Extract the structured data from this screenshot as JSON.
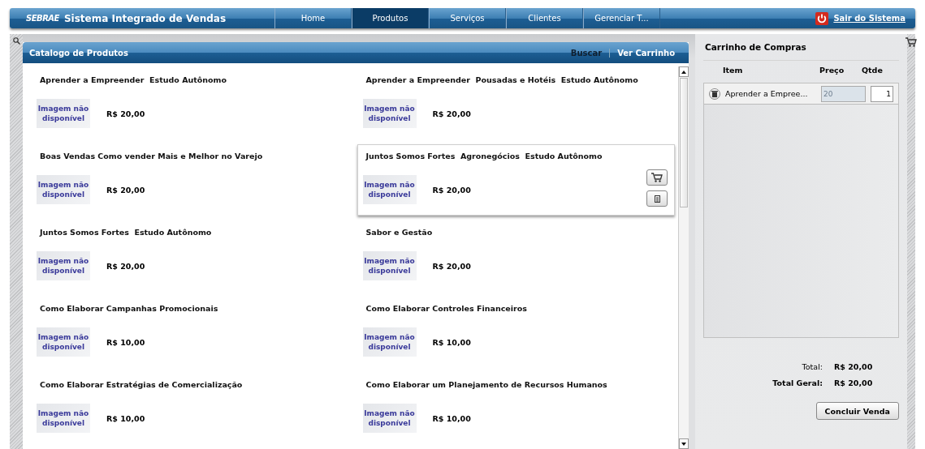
{
  "header": {
    "logo": "SEBRAE",
    "title": "Sistema Integrado de Vendas",
    "logout": "Sair do Sistema"
  },
  "nav": [
    {
      "label": "Home",
      "selected": false
    },
    {
      "label": "Produtos",
      "selected": true
    },
    {
      "label": "Serviços",
      "selected": false
    },
    {
      "label": "Clientes",
      "selected": false
    },
    {
      "label": "Gerenciar T...",
      "selected": false
    }
  ],
  "catalog": {
    "title": "Catalogo de Produtos",
    "actions": [
      "Buscar",
      "Ver Carrinho"
    ],
    "products": [
      {
        "name": "Aprender a Empreender  Estudo Autônomo",
        "image": "Imagem não disponível",
        "price": "R$ 20,00",
        "hovered": false
      },
      {
        "name": "Aprender a Empreender  Pousadas e Hotéis  Estudo Autônomo",
        "image": "Imagem não disponível",
        "price": "R$ 20,00",
        "hovered": false
      },
      {
        "name": "Boas Vendas Como vender Mais e Melhor no Varejo",
        "image": "Imagem não disponível",
        "price": "R$ 20,00",
        "hovered": false
      },
      {
        "name": "Juntos Somos Fortes  Agronegócios  Estudo Autônomo",
        "image": "Imagem não disponível",
        "price": "R$ 20,00",
        "hovered": true
      },
      {
        "name": "Juntos Somos Fortes  Estudo Autônomo",
        "image": "Imagem não disponível",
        "price": "R$ 20,00",
        "hovered": false
      },
      {
        "name": "Sabor e Gestão",
        "image": "Imagem não disponível",
        "price": "R$ 20,00",
        "hovered": false
      },
      {
        "name": "Como Elaborar Campanhas Promocionais",
        "image": "Imagem não disponível",
        "price": "R$ 10,00",
        "hovered": false
      },
      {
        "name": "Como Elaborar Controles Financeiros",
        "image": "Imagem não disponível",
        "price": "R$ 10,00",
        "hovered": false
      },
      {
        "name": "Como Elaborar Estratégias de Comercialização",
        "image": "Imagem não disponível",
        "price": "R$ 10,00",
        "hovered": false
      },
      {
        "name": "Como Elaborar um Planejamento de Recursos Humanos",
        "image": "Imagem não disponível",
        "price": "R$ 10,00",
        "hovered": false
      }
    ]
  },
  "cart": {
    "title": "Carrinho de Compras",
    "columns": [
      "Item",
      "Preço",
      "Qtde"
    ],
    "items": [
      {
        "name": "Aprender a Empree...",
        "price": "20",
        "quantity": "1"
      }
    ],
    "total_label": "Total:",
    "total": "R$ 20,00",
    "grand_total_label": "Total Geral:",
    "grand_total": "R$ 20,00",
    "button": "Concluir Venda"
  }
}
